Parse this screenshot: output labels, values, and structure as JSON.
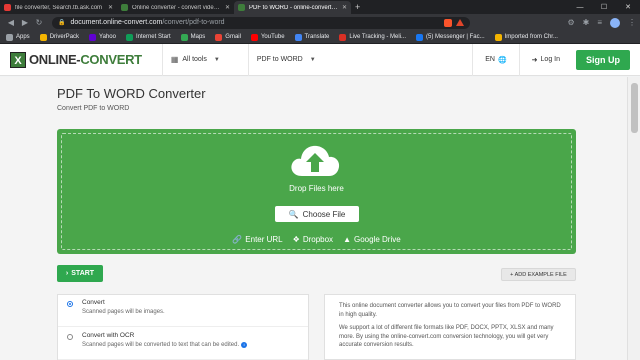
{
  "browser": {
    "tabs": [
      {
        "title": "file converter, Search.tb.ask.com",
        "favicon_color": "#e53935",
        "active": false
      },
      {
        "title": "Online converter - convert video, imag",
        "favicon_color": "#3e7d3b",
        "active": false
      },
      {
        "title": "PDF to WORD - online-convert.com",
        "favicon_color": "#3e7d3b",
        "active": true
      }
    ],
    "new_tab": "+",
    "url_domain": "document.online-convert.com",
    "url_path": "/convert/pdf-to-word"
  },
  "bookmarks": [
    {
      "label": "Apps",
      "color": "#9aa0a6"
    },
    {
      "label": "DriverPack",
      "color": "#f4b400"
    },
    {
      "label": "Yahoo",
      "color": "#6001d2"
    },
    {
      "label": "Internet Start",
      "color": "#0f9d58"
    },
    {
      "label": "Maps",
      "color": "#34a853"
    },
    {
      "label": "Gmail",
      "color": "#ea4335"
    },
    {
      "label": "YouTube",
      "color": "#ff0000"
    },
    {
      "label": "Translate",
      "color": "#4285f4"
    },
    {
      "label": "Live Tracking - Meli...",
      "color": "#d93025"
    },
    {
      "label": "(5) Messenger | Fac...",
      "color": "#1877f2"
    },
    {
      "label": "Imported from Chr...",
      "color": "#f4b400"
    }
  ],
  "header": {
    "logo_part1": "ONLINE-",
    "logo_part2": "CONVERT",
    "all_tools": "All tools",
    "converter_menu": "PDF to WORD",
    "language": "EN",
    "login": "Log In",
    "signup": "Sign Up"
  },
  "main": {
    "title": "PDF To WORD Converter",
    "subtitle": "Convert PDF to WORD",
    "drop_text": "Drop Files here",
    "choose_file": "Choose File",
    "sources": [
      "Enter URL",
      "Dropbox",
      "Google Drive"
    ],
    "start": "START",
    "add_example": "+ ADD EXAMPLE FILE",
    "options": [
      {
        "title": "Convert",
        "desc": "Scanned pages will be images.",
        "checked": true
      },
      {
        "title": "Convert with OCR",
        "desc": "Scanned pages will be converted to text that can be edited.",
        "checked": false
      }
    ],
    "info": [
      "This online document converter allows you to convert your files from PDF to WORD in high quality.",
      "We support a lot of different file formats like PDF, DOCX, PPTX, XLSX and many more. By using the online-convert.com conversion technology, you will get very accurate conversion results."
    ]
  },
  "colors": {
    "brand_green": "#4aa64a",
    "button_green": "#2fa84f"
  }
}
